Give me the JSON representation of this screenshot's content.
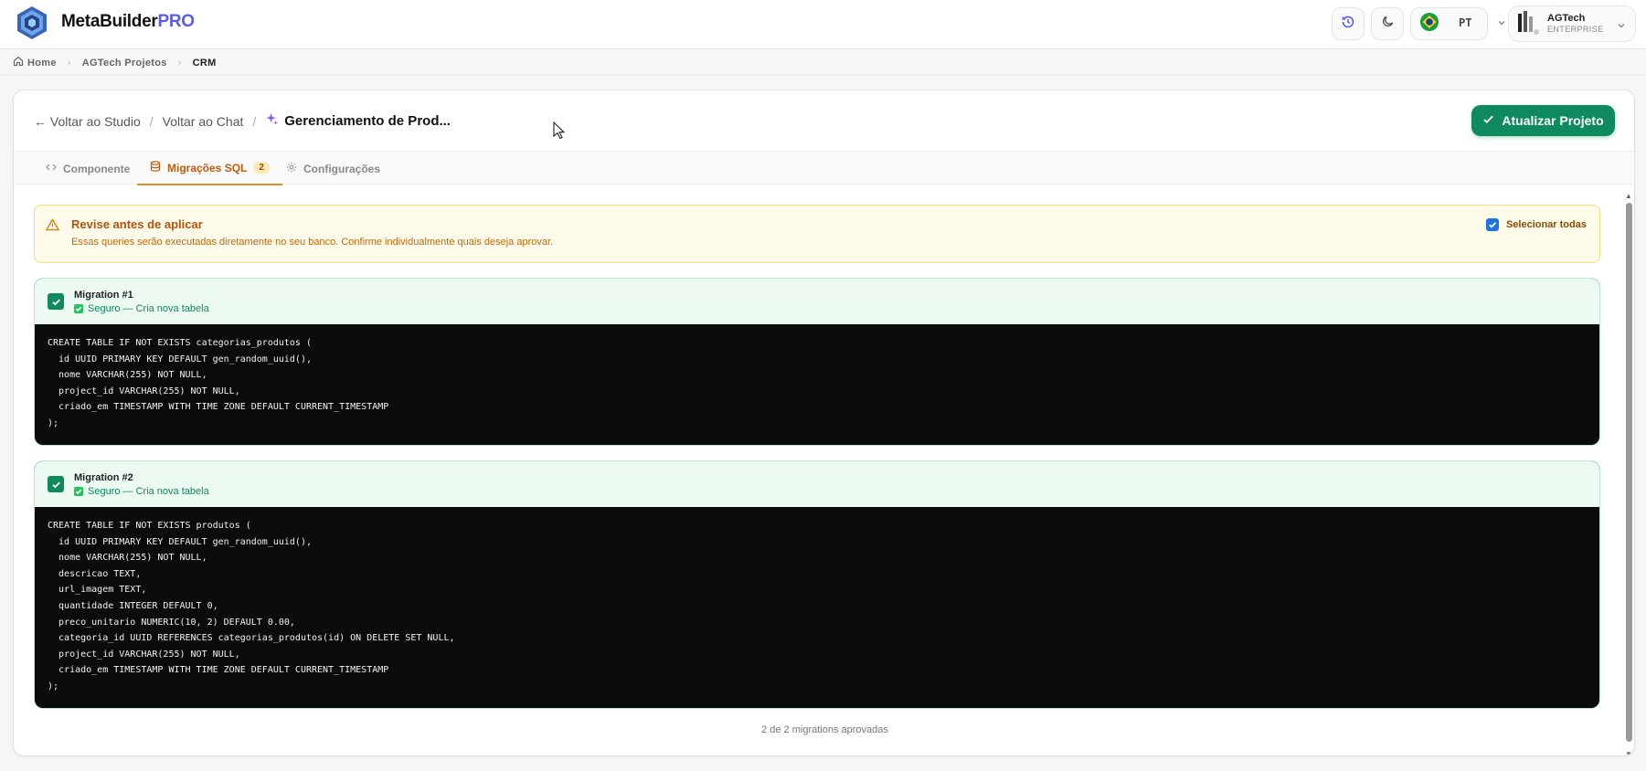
{
  "brand": {
    "name": "MetaBuilder",
    "suffix": "PRO"
  },
  "header": {
    "lang_code": "PT",
    "user": {
      "name": "AGTech",
      "plan": "ENTERPRISE"
    }
  },
  "breadcrumb": {
    "home": "Home",
    "project": "AGTech Projetos",
    "current": "CRM"
  },
  "card": {
    "back_studio": "← Voltar ao Studio",
    "back_chat": "Voltar ao Chat",
    "title": "Gerenciamento de Prod...",
    "update_button": "Atualizar Projeto"
  },
  "tabs": [
    {
      "label": "Componente"
    },
    {
      "label": "Migrações SQL",
      "badge": "2"
    },
    {
      "label": "Configurações"
    }
  ],
  "warning": {
    "title": "Revise antes de aplicar",
    "description": "Essas queries serão executadas diretamente no seu banco. Confirme individualmente quais deseja aprovar.",
    "select_all": "Selecionar todas"
  },
  "migrations": [
    {
      "title": "Migration #1",
      "status": "Seguro — Cria nova tabela",
      "code": "CREATE TABLE IF NOT EXISTS categorias_produtos (\n  id UUID PRIMARY KEY DEFAULT gen_random_uuid(),\n  nome VARCHAR(255) NOT NULL,\n  project_id VARCHAR(255) NOT NULL,\n  criado_em TIMESTAMP WITH TIME ZONE DEFAULT CURRENT_TIMESTAMP\n);"
    },
    {
      "title": "Migration #2",
      "status": "Seguro — Cria nova tabela",
      "code": "CREATE TABLE IF NOT EXISTS produtos (\n  id UUID PRIMARY KEY DEFAULT gen_random_uuid(),\n  nome VARCHAR(255) NOT NULL,\n  descricao TEXT,\n  url_imagem TEXT,\n  quantidade INTEGER DEFAULT 0,\n  preco_unitario NUMERIC(10, 2) DEFAULT 0.00,\n  categoria_id UUID REFERENCES categorias_produtos(id) ON DELETE SET NULL,\n  project_id VARCHAR(255) NOT NULL,\n  criado_em TIMESTAMP WITH TIME ZONE DEFAULT CURRENT_TIMESTAMP\n);"
    }
  ],
  "footer": {
    "approved_count": "2 de 2 migrations aprovadas"
  },
  "colors": {
    "primary": "#0f8a5f",
    "brand_accent": "#5b5ce6",
    "warning": "#b45309"
  }
}
